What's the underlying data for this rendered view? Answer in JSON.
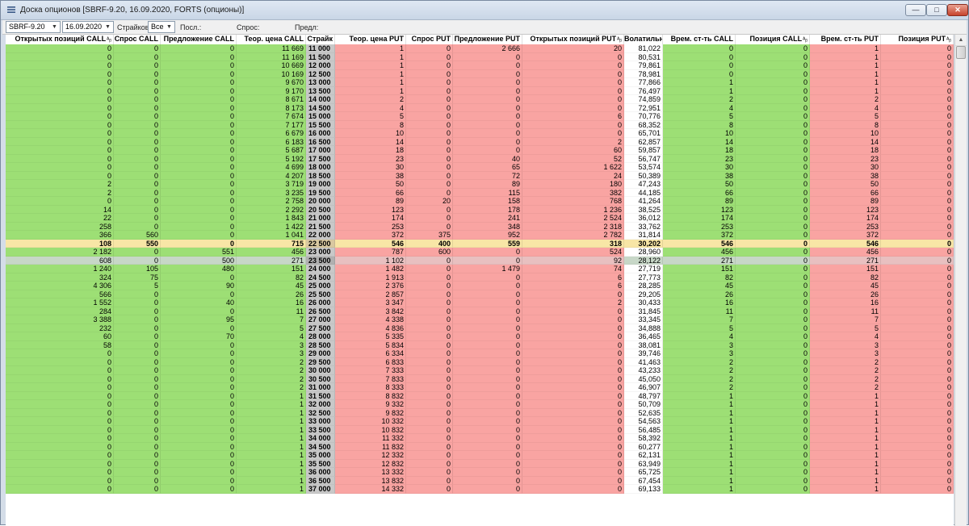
{
  "window": {
    "title": "Доска опционов [SBRF-9.20, 16.09.2020, FORTS (опционы)]",
    "min_label": "—",
    "max_label": "□",
    "close_label": "✕"
  },
  "toolbar": {
    "instrument": "SBRF-9.20",
    "date": "16.09.2020",
    "strikes_label": "Страйков:",
    "strikes_value": "Все",
    "last_label": "Посл.:",
    "bid_label": "Спрос:",
    "ask_label": "Предл:"
  },
  "columns": [
    {
      "key": "oi_call",
      "label": "Открытых позиций CALL",
      "sort": true
    },
    {
      "key": "bid_call",
      "label": "Спрос CALL",
      "sort": false
    },
    {
      "key": "ask_call",
      "label": "Предложение CALL",
      "sort": false
    },
    {
      "key": "theo_call",
      "label": "Теор. цена CALL",
      "sort": false
    },
    {
      "key": "strike",
      "label": "Страйк",
      "sort": false
    },
    {
      "key": "theo_put",
      "label": "Теор. цена PUT",
      "sort": false
    },
    {
      "key": "bid_put",
      "label": "Спрос PUT",
      "sort": false
    },
    {
      "key": "ask_put",
      "label": "Предложение PUT",
      "sort": false
    },
    {
      "key": "oi_put",
      "label": "Открытых позиций PUT",
      "sort": true
    },
    {
      "key": "vol",
      "label": "Волатильн",
      "sort": false
    },
    {
      "key": "tv_call",
      "label": "Врем. ст-ть CALL",
      "sort": false
    },
    {
      "key": "pos_call",
      "label": "Позиция CALL",
      "sort": true
    },
    {
      "key": "tv_put",
      "label": "Врем. ст-ть PUT",
      "sort": false
    },
    {
      "key": "pos_put",
      "label": "Позиция PUT",
      "sort": true
    }
  ],
  "atm_index": 23,
  "selected_index": 25,
  "rows": [
    [
      "0",
      "0",
      "0",
      "11 669",
      "11 000",
      "1",
      "0",
      "2 666",
      "20",
      "81,022",
      "0",
      "0",
      "1",
      "0"
    ],
    [
      "0",
      "0",
      "0",
      "11 169",
      "11 500",
      "1",
      "0",
      "0",
      "0",
      "80,531",
      "0",
      "0",
      "1",
      "0"
    ],
    [
      "0",
      "0",
      "0",
      "10 669",
      "12 000",
      "1",
      "0",
      "0",
      "0",
      "79,861",
      "0",
      "0",
      "1",
      "0"
    ],
    [
      "0",
      "0",
      "0",
      "10 169",
      "12 500",
      "1",
      "0",
      "0",
      "0",
      "78,981",
      "0",
      "0",
      "1",
      "0"
    ],
    [
      "0",
      "0",
      "0",
      "9 670",
      "13 000",
      "1",
      "0",
      "0",
      "0",
      "77,866",
      "1",
      "0",
      "1",
      "0"
    ],
    [
      "0",
      "0",
      "0",
      "9 170",
      "13 500",
      "1",
      "0",
      "0",
      "0",
      "76,497",
      "1",
      "0",
      "1",
      "0"
    ],
    [
      "0",
      "0",
      "0",
      "8 671",
      "14 000",
      "2",
      "0",
      "0",
      "0",
      "74,859",
      "2",
      "0",
      "2",
      "0"
    ],
    [
      "0",
      "0",
      "0",
      "8 173",
      "14 500",
      "4",
      "0",
      "0",
      "0",
      "72,951",
      "4",
      "0",
      "4",
      "0"
    ],
    [
      "0",
      "0",
      "0",
      "7 674",
      "15 000",
      "5",
      "0",
      "0",
      "6",
      "70,776",
      "5",
      "0",
      "5",
      "0"
    ],
    [
      "0",
      "0",
      "0",
      "7 177",
      "15 500",
      "8",
      "0",
      "0",
      "0",
      "68,352",
      "8",
      "0",
      "8",
      "0"
    ],
    [
      "0",
      "0",
      "0",
      "6 679",
      "16 000",
      "10",
      "0",
      "0",
      "0",
      "65,701",
      "10",
      "0",
      "10",
      "0"
    ],
    [
      "0",
      "0",
      "0",
      "6 183",
      "16 500",
      "14",
      "0",
      "0",
      "2",
      "62,857",
      "14",
      "0",
      "14",
      "0"
    ],
    [
      "0",
      "0",
      "0",
      "5 687",
      "17 000",
      "18",
      "0",
      "0",
      "60",
      "59,857",
      "18",
      "0",
      "18",
      "0"
    ],
    [
      "0",
      "0",
      "0",
      "5 192",
      "17 500",
      "23",
      "0",
      "40",
      "52",
      "56,747",
      "23",
      "0",
      "23",
      "0"
    ],
    [
      "0",
      "0",
      "0",
      "4 699",
      "18 000",
      "30",
      "0",
      "65",
      "1 622",
      "53,574",
      "30",
      "0",
      "30",
      "0"
    ],
    [
      "0",
      "0",
      "0",
      "4 207",
      "18 500",
      "38",
      "0",
      "72",
      "24",
      "50,389",
      "38",
      "0",
      "38",
      "0"
    ],
    [
      "2",
      "0",
      "0",
      "3 719",
      "19 000",
      "50",
      "0",
      "89",
      "180",
      "47,243",
      "50",
      "0",
      "50",
      "0"
    ],
    [
      "2",
      "0",
      "0",
      "3 235",
      "19 500",
      "66",
      "0",
      "115",
      "382",
      "44,185",
      "66",
      "0",
      "66",
      "0"
    ],
    [
      "0",
      "0",
      "0",
      "2 758",
      "20 000",
      "89",
      "20",
      "158",
      "768",
      "41,264",
      "89",
      "0",
      "89",
      "0"
    ],
    [
      "14",
      "0",
      "0",
      "2 292",
      "20 500",
      "123",
      "0",
      "178",
      "1 236",
      "38,525",
      "123",
      "0",
      "123",
      "0"
    ],
    [
      "22",
      "0",
      "0",
      "1 843",
      "21 000",
      "174",
      "0",
      "241",
      "2 524",
      "36,012",
      "174",
      "0",
      "174",
      "0"
    ],
    [
      "258",
      "0",
      "0",
      "1 422",
      "21 500",
      "253",
      "0",
      "348",
      "2 318",
      "33,762",
      "253",
      "0",
      "253",
      "0"
    ],
    [
      "366",
      "560",
      "0",
      "1 041",
      "22 000",
      "372",
      "375",
      "952",
      "2 782",
      "31,814",
      "372",
      "0",
      "372",
      "0"
    ],
    [
      "108",
      "550",
      "0",
      "715",
      "22 500",
      "546",
      "400",
      "559",
      "318",
      "30,202",
      "546",
      "0",
      "546",
      "0"
    ],
    [
      "2 182",
      "0",
      "551",
      "456",
      "23 000",
      "787",
      "600",
      "0",
      "524",
      "28,960",
      "456",
      "0",
      "456",
      "0"
    ],
    [
      "608",
      "0",
      "500",
      "271",
      "23 500",
      "1 102",
      "0",
      "0",
      "92",
      "28,122",
      "271",
      "0",
      "271",
      "0"
    ],
    [
      "1 240",
      "105",
      "480",
      "151",
      "24 000",
      "1 482",
      "0",
      "1 479",
      "74",
      "27,719",
      "151",
      "0",
      "151",
      "0"
    ],
    [
      "324",
      "75",
      "0",
      "82",
      "24 500",
      "1 913",
      "0",
      "0",
      "6",
      "27,773",
      "82",
      "0",
      "82",
      "0"
    ],
    [
      "4 306",
      "5",
      "90",
      "45",
      "25 000",
      "2 376",
      "0",
      "0",
      "6",
      "28,285",
      "45",
      "0",
      "45",
      "0"
    ],
    [
      "566",
      "0",
      "0",
      "26",
      "25 500",
      "2 857",
      "0",
      "0",
      "0",
      "29,205",
      "26",
      "0",
      "26",
      "0"
    ],
    [
      "1 552",
      "0",
      "40",
      "16",
      "26 000",
      "3 347",
      "0",
      "0",
      "2",
      "30,433",
      "16",
      "0",
      "16",
      "0"
    ],
    [
      "284",
      "0",
      "0",
      "11",
      "26 500",
      "3 842",
      "0",
      "0",
      "0",
      "31,845",
      "11",
      "0",
      "11",
      "0"
    ],
    [
      "3 388",
      "0",
      "95",
      "7",
      "27 000",
      "4 338",
      "0",
      "0",
      "0",
      "33,345",
      "7",
      "0",
      "7",
      "0"
    ],
    [
      "232",
      "0",
      "0",
      "5",
      "27 500",
      "4 836",
      "0",
      "0",
      "0",
      "34,888",
      "5",
      "0",
      "5",
      "0"
    ],
    [
      "60",
      "0",
      "70",
      "4",
      "28 000",
      "5 335",
      "0",
      "0",
      "0",
      "36,465",
      "4",
      "0",
      "4",
      "0"
    ],
    [
      "58",
      "0",
      "0",
      "3",
      "28 500",
      "5 834",
      "0",
      "0",
      "0",
      "38,081",
      "3",
      "0",
      "3",
      "0"
    ],
    [
      "0",
      "0",
      "0",
      "3",
      "29 000",
      "6 334",
      "0",
      "0",
      "0",
      "39,746",
      "3",
      "0",
      "3",
      "0"
    ],
    [
      "0",
      "0",
      "0",
      "2",
      "29 500",
      "6 833",
      "0",
      "0",
      "0",
      "41,463",
      "2",
      "0",
      "2",
      "0"
    ],
    [
      "0",
      "0",
      "0",
      "2",
      "30 000",
      "7 333",
      "0",
      "0",
      "0",
      "43,233",
      "2",
      "0",
      "2",
      "0"
    ],
    [
      "0",
      "0",
      "0",
      "2",
      "30 500",
      "7 833",
      "0",
      "0",
      "0",
      "45,050",
      "2",
      "0",
      "2",
      "0"
    ],
    [
      "0",
      "0",
      "0",
      "2",
      "31 000",
      "8 333",
      "0",
      "0",
      "0",
      "46,907",
      "2",
      "0",
      "2",
      "0"
    ],
    [
      "0",
      "0",
      "0",
      "1",
      "31 500",
      "8 832",
      "0",
      "0",
      "0",
      "48,797",
      "1",
      "0",
      "1",
      "0"
    ],
    [
      "0",
      "0",
      "0",
      "1",
      "32 000",
      "9 332",
      "0",
      "0",
      "0",
      "50,709",
      "1",
      "0",
      "1",
      "0"
    ],
    [
      "0",
      "0",
      "0",
      "1",
      "32 500",
      "9 832",
      "0",
      "0",
      "0",
      "52,635",
      "1",
      "0",
      "1",
      "0"
    ],
    [
      "0",
      "0",
      "0",
      "1",
      "33 000",
      "10 332",
      "0",
      "0",
      "0",
      "54,563",
      "1",
      "0",
      "1",
      "0"
    ],
    [
      "0",
      "0",
      "0",
      "1",
      "33 500",
      "10 832",
      "0",
      "0",
      "0",
      "56,485",
      "1",
      "0",
      "1",
      "0"
    ],
    [
      "0",
      "0",
      "0",
      "1",
      "34 000",
      "11 332",
      "0",
      "0",
      "0",
      "58,392",
      "1",
      "0",
      "1",
      "0"
    ],
    [
      "0",
      "0",
      "0",
      "1",
      "34 500",
      "11 832",
      "0",
      "0",
      "0",
      "60,277",
      "1",
      "0",
      "1",
      "0"
    ],
    [
      "0",
      "0",
      "0",
      "1",
      "35 000",
      "12 332",
      "0",
      "0",
      "0",
      "62,131",
      "1",
      "0",
      "1",
      "0"
    ],
    [
      "0",
      "0",
      "0",
      "1",
      "35 500",
      "12 832",
      "0",
      "0",
      "0",
      "63,949",
      "1",
      "0",
      "1",
      "0"
    ],
    [
      "0",
      "0",
      "0",
      "1",
      "36 000",
      "13 332",
      "0",
      "0",
      "0",
      "65,725",
      "1",
      "0",
      "1",
      "0"
    ],
    [
      "0",
      "0",
      "0",
      "1",
      "36 500",
      "13 832",
      "0",
      "0",
      "0",
      "67,454",
      "1",
      "0",
      "1",
      "0"
    ],
    [
      "0",
      "0",
      "0",
      "1",
      "37 000",
      "14 332",
      "0",
      "0",
      "0",
      "69,133",
      "1",
      "0",
      "1",
      "0"
    ]
  ]
}
